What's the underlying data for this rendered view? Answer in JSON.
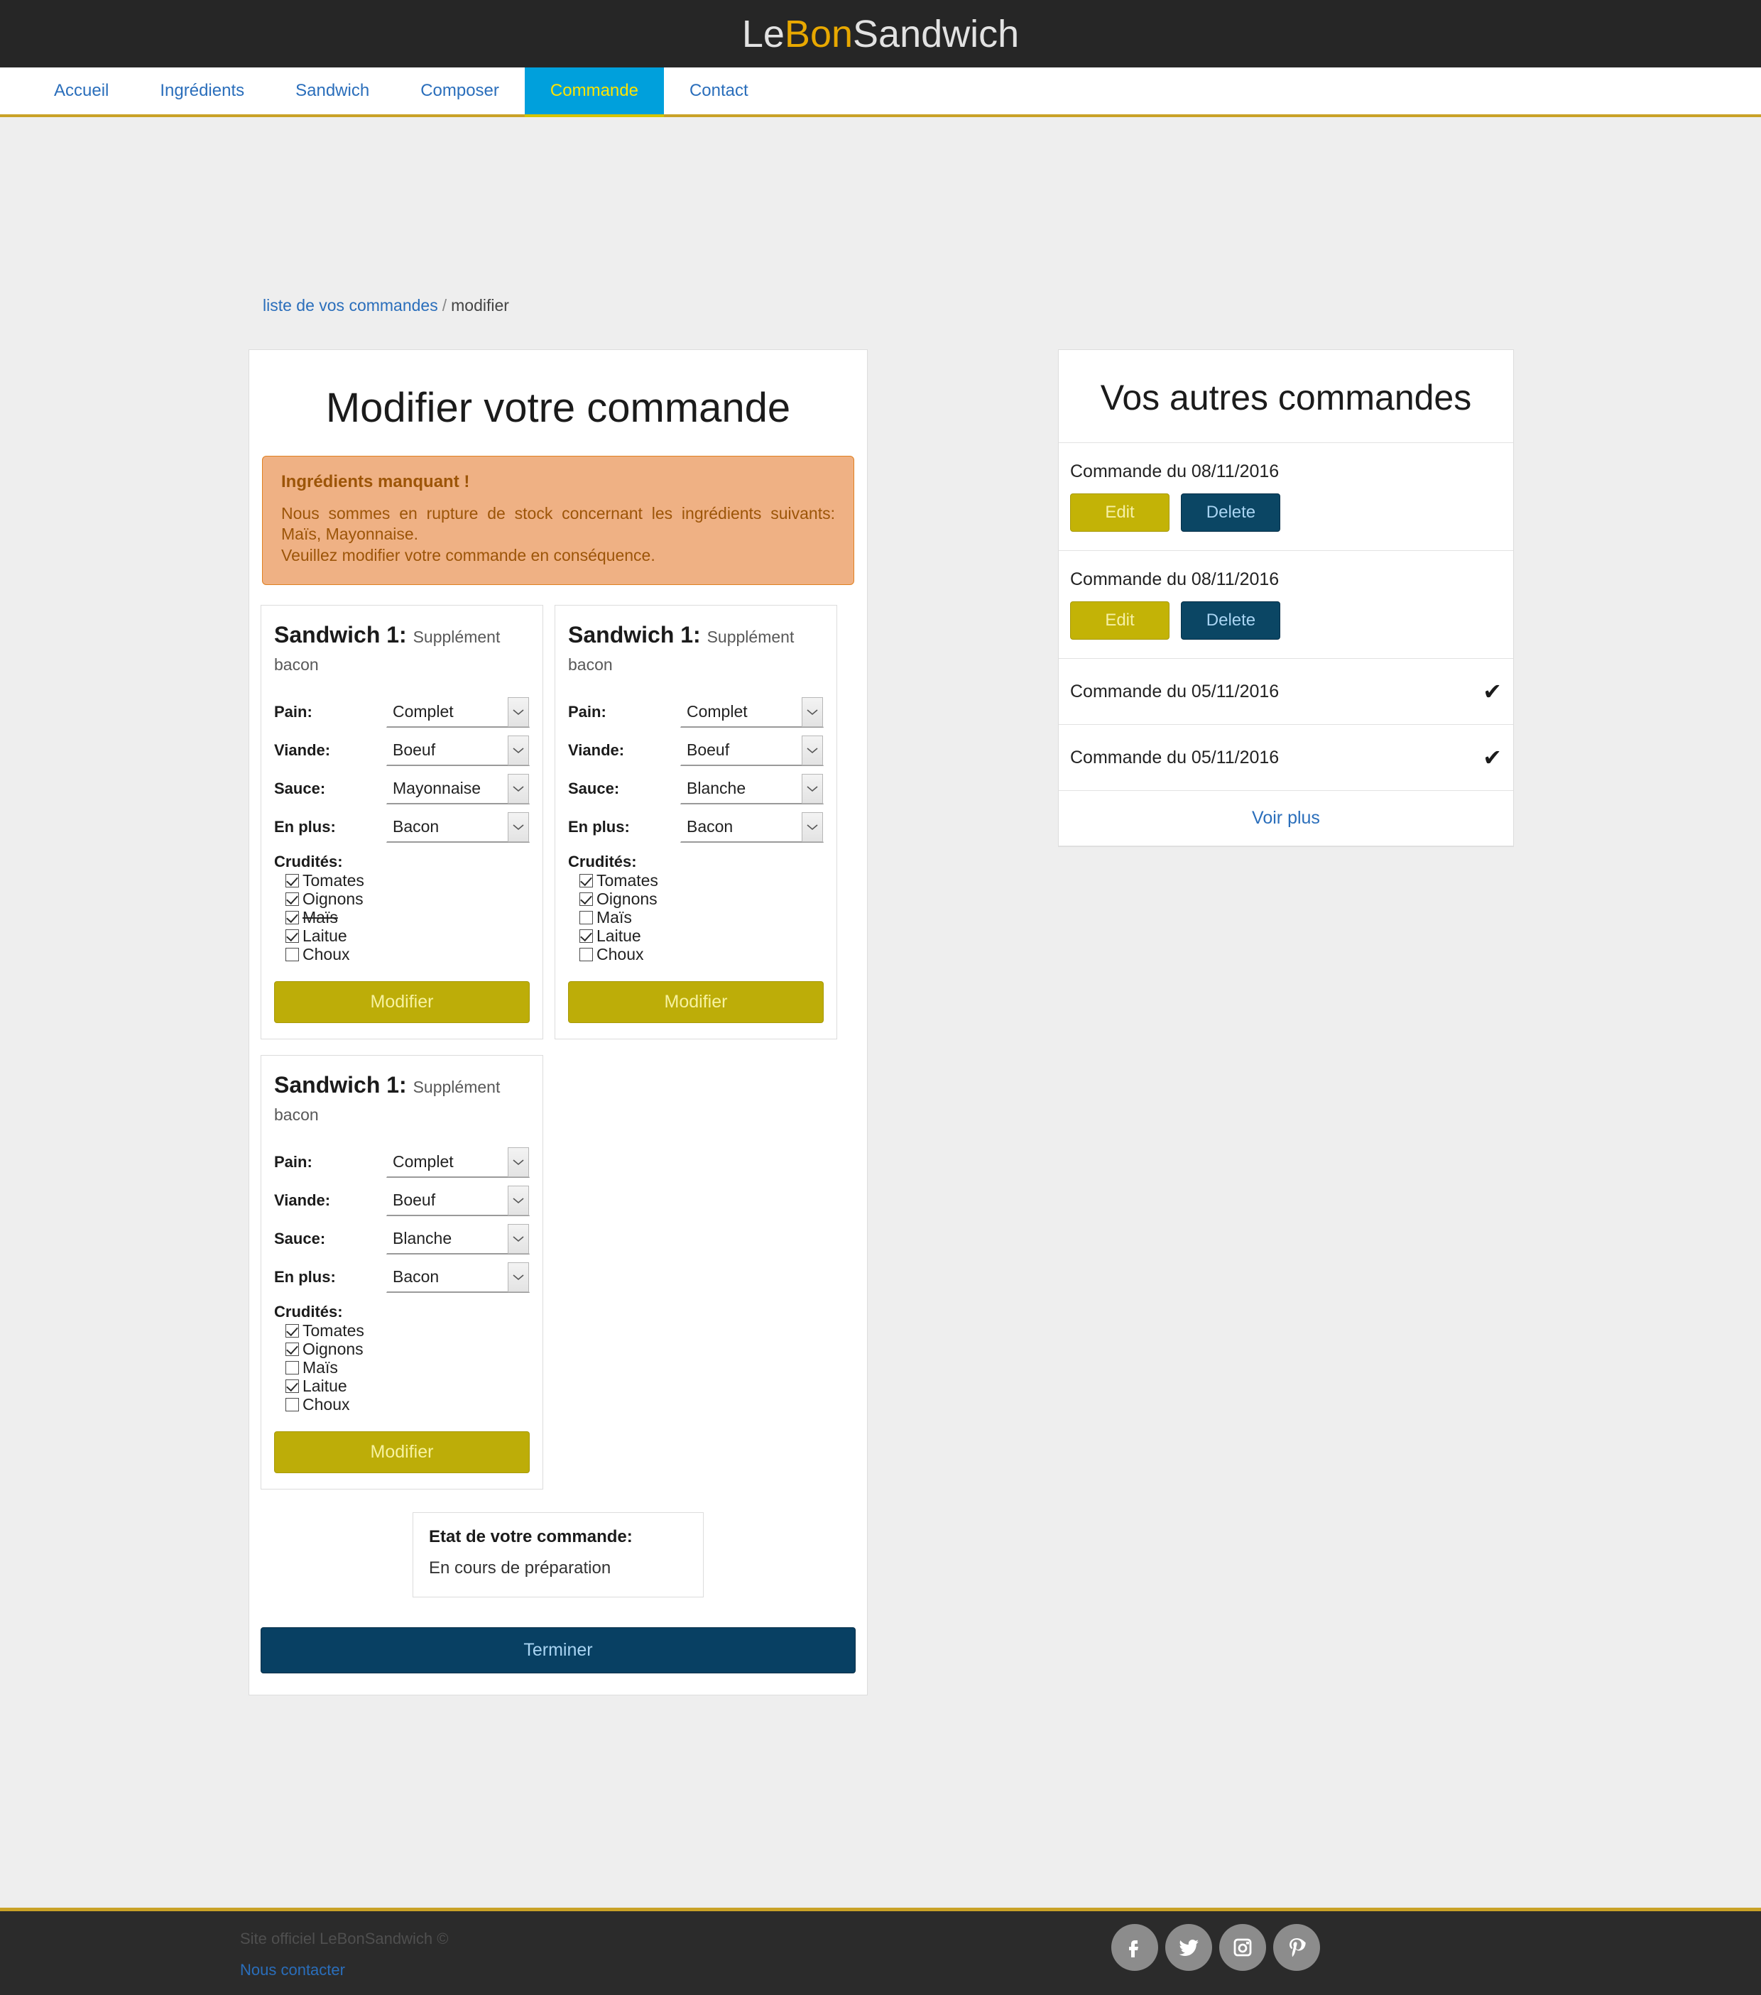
{
  "header": {
    "brand_part1": "Le",
    "brand_part2": "Bon",
    "brand_part3": "Sandwich"
  },
  "nav": {
    "items": [
      {
        "label": "Accueil",
        "active": false
      },
      {
        "label": "Ingrédients",
        "active": false
      },
      {
        "label": "Sandwich",
        "active": false
      },
      {
        "label": "Composer",
        "active": false
      },
      {
        "label": "Commande",
        "active": true
      },
      {
        "label": "Contact",
        "active": false
      }
    ]
  },
  "breadcrumb": {
    "link": "liste de vos commandes",
    "separator": "/",
    "current": "modifier"
  },
  "main": {
    "title": "Modifier votre commande",
    "alert": {
      "title": "Ingrédients manquant !",
      "line1": "Nous sommes en rupture de stock concernant les ingrédients suivants: Maïs, Mayonnaise.",
      "line2": "Veuillez modifier votre commande en conséquence."
    },
    "field_labels": {
      "pain": "Pain:",
      "viande": "Viande:",
      "sauce": "Sauce:",
      "en_plus": "En plus:",
      "crudites": "Crudités:"
    },
    "modify_button": "Modifier",
    "cards": [
      {
        "title": "Sandwich 1:",
        "subtitle": "Supplément bacon",
        "pain": "Complet",
        "viande": "Boeuf",
        "sauce": "Mayonnaise",
        "en_plus": "Bacon",
        "crudites": [
          {
            "label": "Tomates",
            "checked": true,
            "unavailable": false
          },
          {
            "label": "Oignons",
            "checked": true,
            "unavailable": false
          },
          {
            "label": "Maïs",
            "checked": true,
            "unavailable": true
          },
          {
            "label": "Laitue",
            "checked": true,
            "unavailable": false
          },
          {
            "label": "Choux",
            "checked": false,
            "unavailable": false
          }
        ]
      },
      {
        "title": "Sandwich 1:",
        "subtitle": "Supplément bacon",
        "pain": "Complet",
        "viande": "Boeuf",
        "sauce": "Blanche",
        "en_plus": "Bacon",
        "crudites": [
          {
            "label": "Tomates",
            "checked": true,
            "unavailable": false
          },
          {
            "label": "Oignons",
            "checked": true,
            "unavailable": false
          },
          {
            "label": "Maïs",
            "checked": false,
            "unavailable": false
          },
          {
            "label": "Laitue",
            "checked": true,
            "unavailable": false
          },
          {
            "label": "Choux",
            "checked": false,
            "unavailable": false
          }
        ]
      },
      {
        "title": "Sandwich 1:",
        "subtitle": "Supplément bacon",
        "pain": "Complet",
        "viande": "Boeuf",
        "sauce": "Blanche",
        "en_plus": "Bacon",
        "crudites": [
          {
            "label": "Tomates",
            "checked": true,
            "unavailable": false
          },
          {
            "label": "Oignons",
            "checked": true,
            "unavailable": false
          },
          {
            "label": "Maïs",
            "checked": false,
            "unavailable": false
          },
          {
            "label": "Laitue",
            "checked": true,
            "unavailable": false
          },
          {
            "label": "Choux",
            "checked": false,
            "unavailable": false
          }
        ]
      }
    ],
    "etat": {
      "title": "Etat de votre commande:",
      "value": "En cours de préparation"
    },
    "finish_button": "Terminer"
  },
  "sidebar": {
    "title": "Vos autres commandes",
    "orders": [
      {
        "date": "Commande du 08/11/2016",
        "type": "editable",
        "edit_label": "Edit",
        "delete_label": "Delete"
      },
      {
        "date": "Commande du 08/11/2016",
        "type": "editable",
        "edit_label": "Edit",
        "delete_label": "Delete"
      },
      {
        "date": "Commande du 05/11/2016",
        "type": "done",
        "check": "✔"
      },
      {
        "date": "Commande du 05/11/2016",
        "type": "done",
        "check": "✔"
      }
    ],
    "see_more": "Voir plus"
  },
  "footer": {
    "copyright": "Site officiel LeBonSandwich ©",
    "contact_link": "Nous contacter",
    "socials": [
      "facebook-icon",
      "twitter-icon",
      "instagram-icon",
      "pinterest-icon"
    ]
  },
  "colors": {
    "brand_accent": "#e8a800",
    "nav_active_bg": "#00a0dc",
    "nav_active_text": "#ffe400",
    "alert_bg": "#efb184",
    "alert_border": "#e08020",
    "alert_text": "#9c5508",
    "modify_button": "#bdad08",
    "dark_blue": "#084063",
    "gold_rule": "#c9a227"
  }
}
